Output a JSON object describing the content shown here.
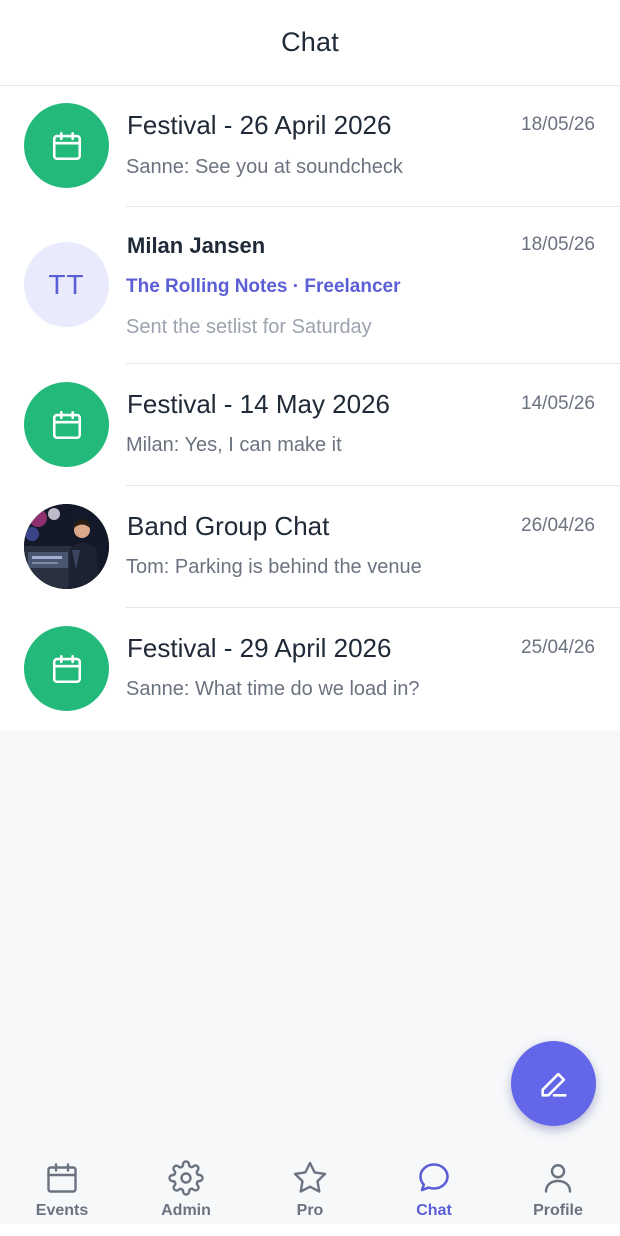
{
  "header": {
    "title": "Chat"
  },
  "colors": {
    "event": "#22b97a",
    "accent": "#5b5fd6",
    "fab": "#6366e8"
  },
  "conversations": [
    {
      "type": "event",
      "icon": "calendar-icon",
      "title": "Festival - 26 April 2026",
      "preview": "Sanne: See you at soundcheck",
      "date": "18/05/26"
    },
    {
      "type": "person",
      "initials": "TT",
      "title": "Milan Jansen",
      "org": "The Rolling Notes · Freelancer",
      "preview": "Sent the setlist for Saturday",
      "date": "18/05/26"
    },
    {
      "type": "event",
      "icon": "calendar-icon",
      "title": "Festival - 14 May 2026",
      "preview": "Milan: Yes, I can make it",
      "date": "14/05/26"
    },
    {
      "type": "group",
      "icon": "group-photo",
      "title": "Band Group Chat",
      "preview": "Tom: Parking is behind the venue",
      "date": "26/04/26"
    },
    {
      "type": "event",
      "icon": "calendar-icon",
      "title": "Festival - 29 April 2026",
      "preview": "Sanne: What time do we load in?",
      "date": "25/04/26"
    }
  ],
  "fab": {
    "icon": "pencil-icon"
  },
  "tabs": [
    {
      "label": "Events",
      "icon": "calendar-icon",
      "active": false
    },
    {
      "label": "Admin",
      "icon": "gear-icon",
      "active": false
    },
    {
      "label": "Pro",
      "icon": "star-icon",
      "active": false
    },
    {
      "label": "Chat",
      "icon": "chat-bubble-icon",
      "active": true
    },
    {
      "label": "Profile",
      "icon": "user-icon",
      "active": false
    }
  ]
}
